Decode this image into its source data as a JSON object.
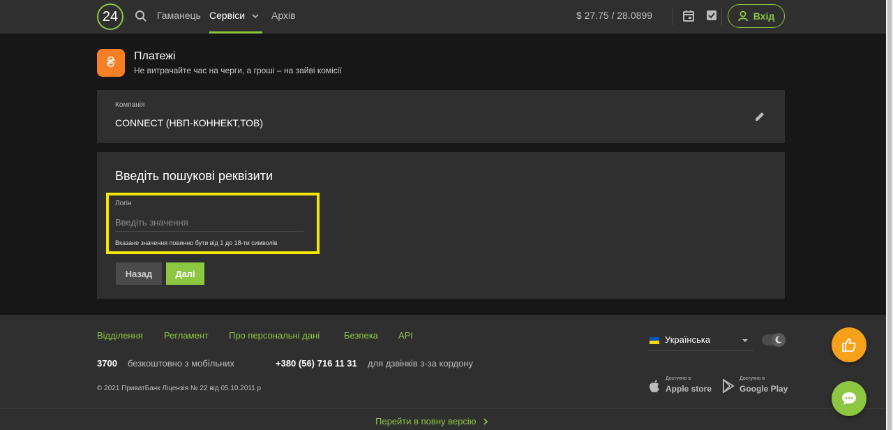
{
  "header": {
    "logo_text": "24",
    "nav": [
      {
        "label": "Гаманець"
      },
      {
        "label": "Сервіси"
      },
      {
        "label": "Архів"
      }
    ],
    "rate": "$  27.75 / 28.0899",
    "login_label": "Вхід"
  },
  "payments": {
    "title": "Платежі",
    "subtitle": "Не витрачайте час на черги, а гроші – на зайві комісії",
    "icon_glyph": "₴"
  },
  "company": {
    "label": "Компанія",
    "value": "CONNECT (НВП-КОННЕКТ,ТОВ)"
  },
  "form": {
    "title": "Введіть пошукові реквізити",
    "field_label": "Логін",
    "field_value": "",
    "field_placeholder": "Введіть значення",
    "field_hint": "Вказане значення повинно бути від 1 до 18-ти символів",
    "back_label": "Назад",
    "next_label": "Далі"
  },
  "footer": {
    "links": [
      {
        "label": "Відділення"
      },
      {
        "label": "Регламент"
      },
      {
        "label": "Про персональні дані"
      },
      {
        "label": "Безпека"
      },
      {
        "label": "API"
      }
    ],
    "phone_short": "3700",
    "phone_short_desc": "безкоштовно з мобільних",
    "phone_long": "+380 (56) 716 11 31",
    "phone_long_desc": "для дзвінків з-за кордону",
    "copyright": "© 2021 ПриватБанк Ліцензія № 22 від 05.10.2011 р",
    "language": "Українська",
    "apple_small": "Доступно в",
    "apple_big": "Apple store",
    "google_small": "Доступно в",
    "google_big": "Google Play",
    "full_version": "Перейти в повну версію"
  },
  "colors": {
    "accent": "#8dc641",
    "payment_icon": "#f67e24",
    "highlight": "#f5e600",
    "like_fab": "#f7a01a"
  },
  "icons": [
    "search-icon",
    "chevron-down-icon",
    "calendar-icon",
    "checklist-icon",
    "user-icon",
    "edit-icon",
    "apple-icon",
    "google-play-icon",
    "thumbs-up-icon",
    "chat-icon",
    "moon-icon",
    "chevron-right-icon"
  ]
}
